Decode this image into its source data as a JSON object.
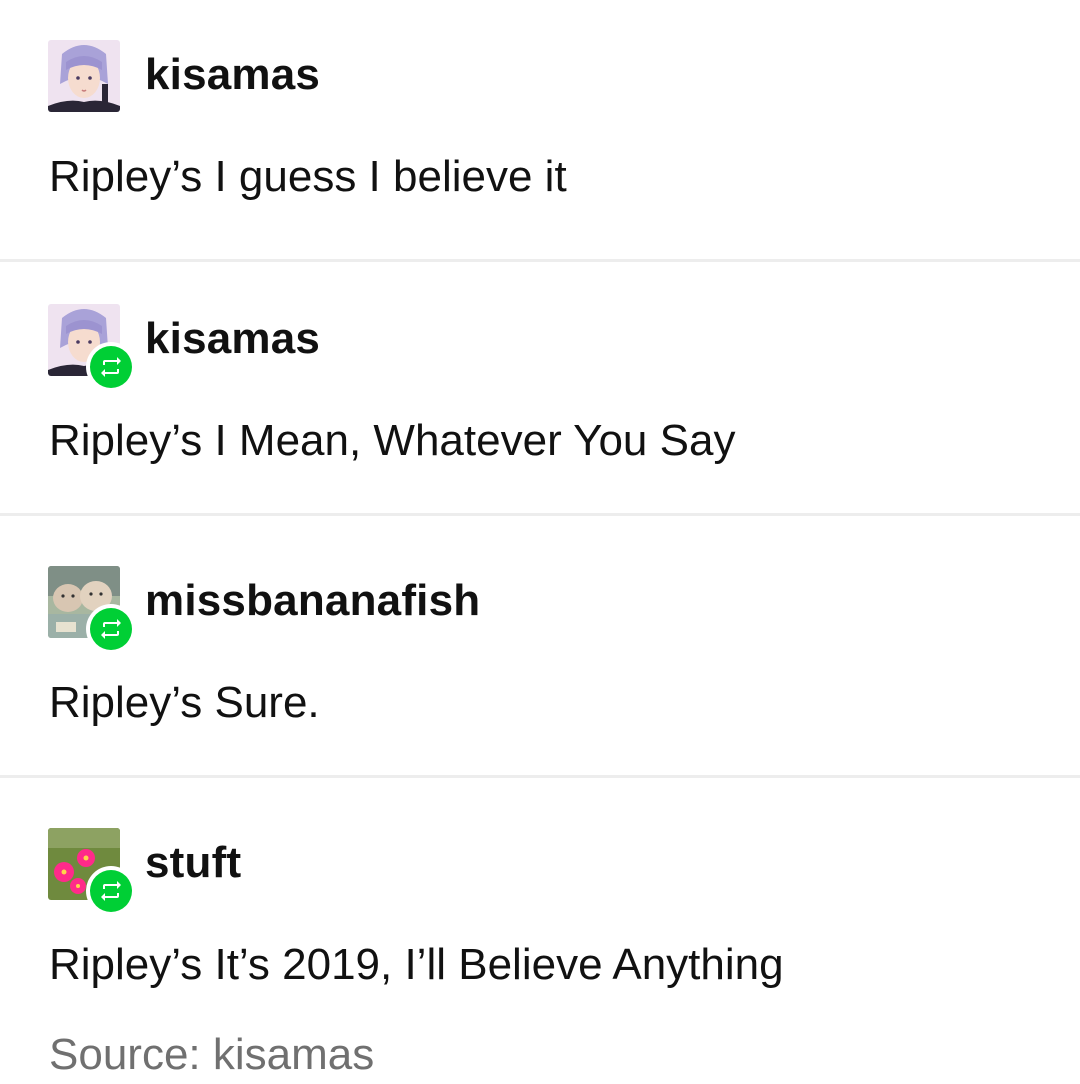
{
  "posts": [
    {
      "username": "kisamas",
      "text": "Ripley’s I guess I believe it",
      "reblogged": false,
      "avatar": "anime-girl-avatar"
    },
    {
      "username": "kisamas",
      "text": "Ripley’s I Mean, Whatever You Say",
      "reblogged": true,
      "avatar": "anime-girl-avatar"
    },
    {
      "username": "missbananafish",
      "text": "Ripley’s Sure.",
      "reblogged": true,
      "avatar": "cats-avatar"
    },
    {
      "username": "stuft",
      "text": "Ripley’s It’s 2019, I’ll Believe Anything",
      "reblogged": true,
      "avatar": "pink-flowers-avatar"
    }
  ],
  "source": "Source: kisamas",
  "colors": {
    "reblog_badge": "#00cf35",
    "divider": "#ededed",
    "source_text": "#707070"
  }
}
